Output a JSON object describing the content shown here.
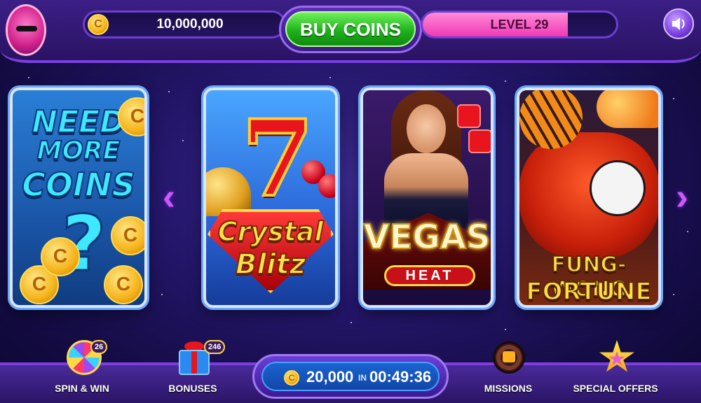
{
  "header": {
    "coin_balance": "10,000,000",
    "coin_symbol": "C",
    "buy_coins_label": "BUY COINS",
    "level_label": "LEVEL 29",
    "level_progress": 0.75
  },
  "carousel": {
    "cards": [
      {
        "lines": [
          "NEED",
          "MORE",
          "COINS"
        ],
        "symbol": "?"
      },
      {
        "lines": [
          "Crystal",
          "Blitz"
        ],
        "numeral": "7"
      },
      {
        "lines": [
          "VEGAS",
          "HEAT"
        ]
      },
      {
        "lines": [
          "FUNG-WONG",
          "FORTUNE"
        ]
      }
    ],
    "prev_arrow": "‹",
    "next_arrow": "›"
  },
  "bottom_nav": {
    "spin_win": {
      "label": "SPIN & WIN",
      "badge": "26"
    },
    "bonuses": {
      "label": "BONUSES",
      "badge": "246"
    },
    "missions": {
      "label": "MISSIONS"
    },
    "special_offers": {
      "label": "SPECIAL OFFERS"
    }
  },
  "timed_bonus": {
    "amount": "20,000",
    "in_label": "IN",
    "timer": "00:49:36"
  },
  "colors": {
    "buy_button": "#1fb21c",
    "level_bar": "#f03ab4",
    "card_border": "#d8e6ff",
    "arrow": "#c65cf5",
    "coin": "#f5b31a"
  },
  "icons": {
    "avatar": "pig-avatar-icon",
    "sound": "speaker-icon",
    "spin": "prize-wheel-icon",
    "bonuses": "gift-icon",
    "missions": "target-lock-icon",
    "offers": "star-icon"
  }
}
